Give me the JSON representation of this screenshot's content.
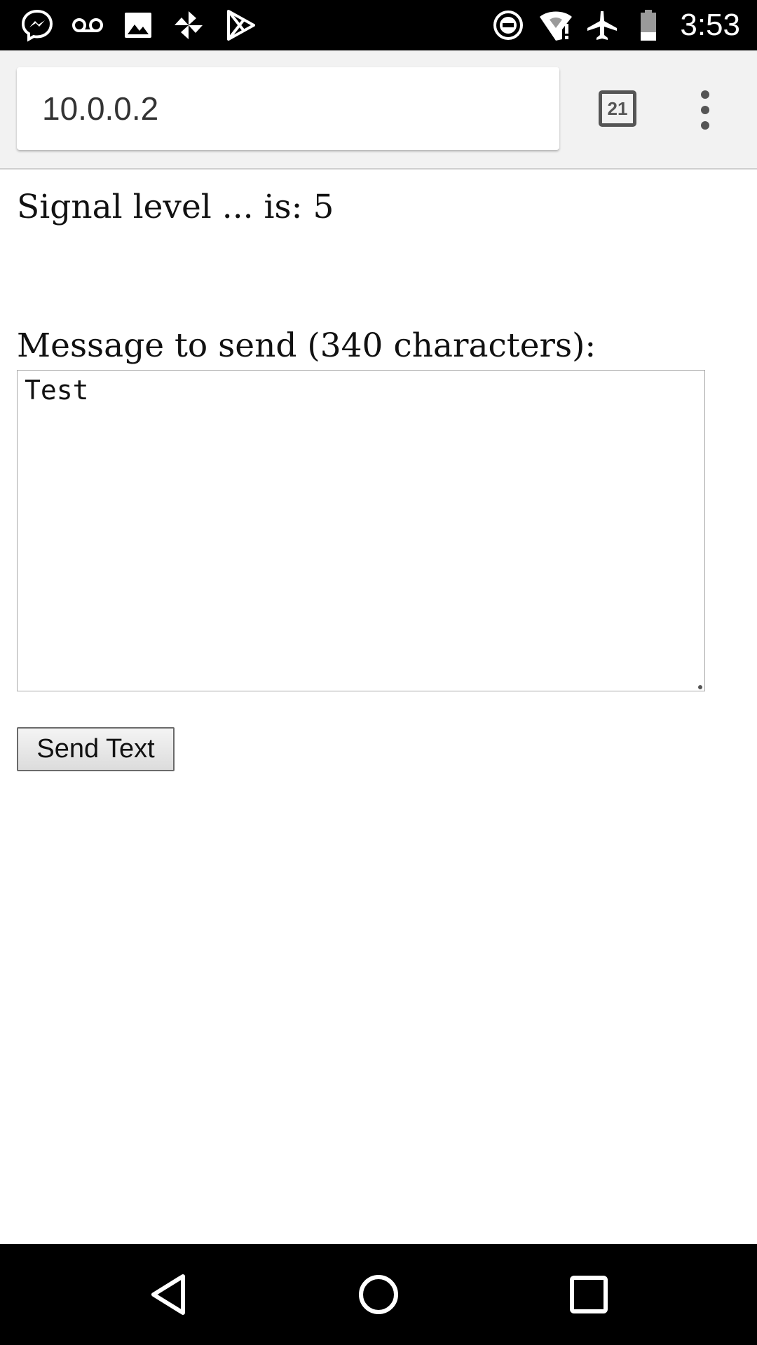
{
  "status_bar": {
    "time": "3:53",
    "left_icons": [
      "messenger-icon",
      "voicemail-icon",
      "image-icon",
      "pinwheel-icon",
      "play-store-icon"
    ],
    "right_icons": [
      "do-not-disturb-icon",
      "wifi-alert-icon",
      "airplane-mode-icon",
      "battery-icon"
    ]
  },
  "browser": {
    "url": "10.0.0.2",
    "tab_count": "21"
  },
  "page": {
    "signal_text": "Signal level ... is: 5",
    "message_label": "Message to send (340 characters):",
    "message_value": "Test",
    "send_button_label": "Send Text"
  },
  "nav_bar": {
    "buttons": [
      "back-icon",
      "home-icon",
      "recents-icon"
    ]
  }
}
